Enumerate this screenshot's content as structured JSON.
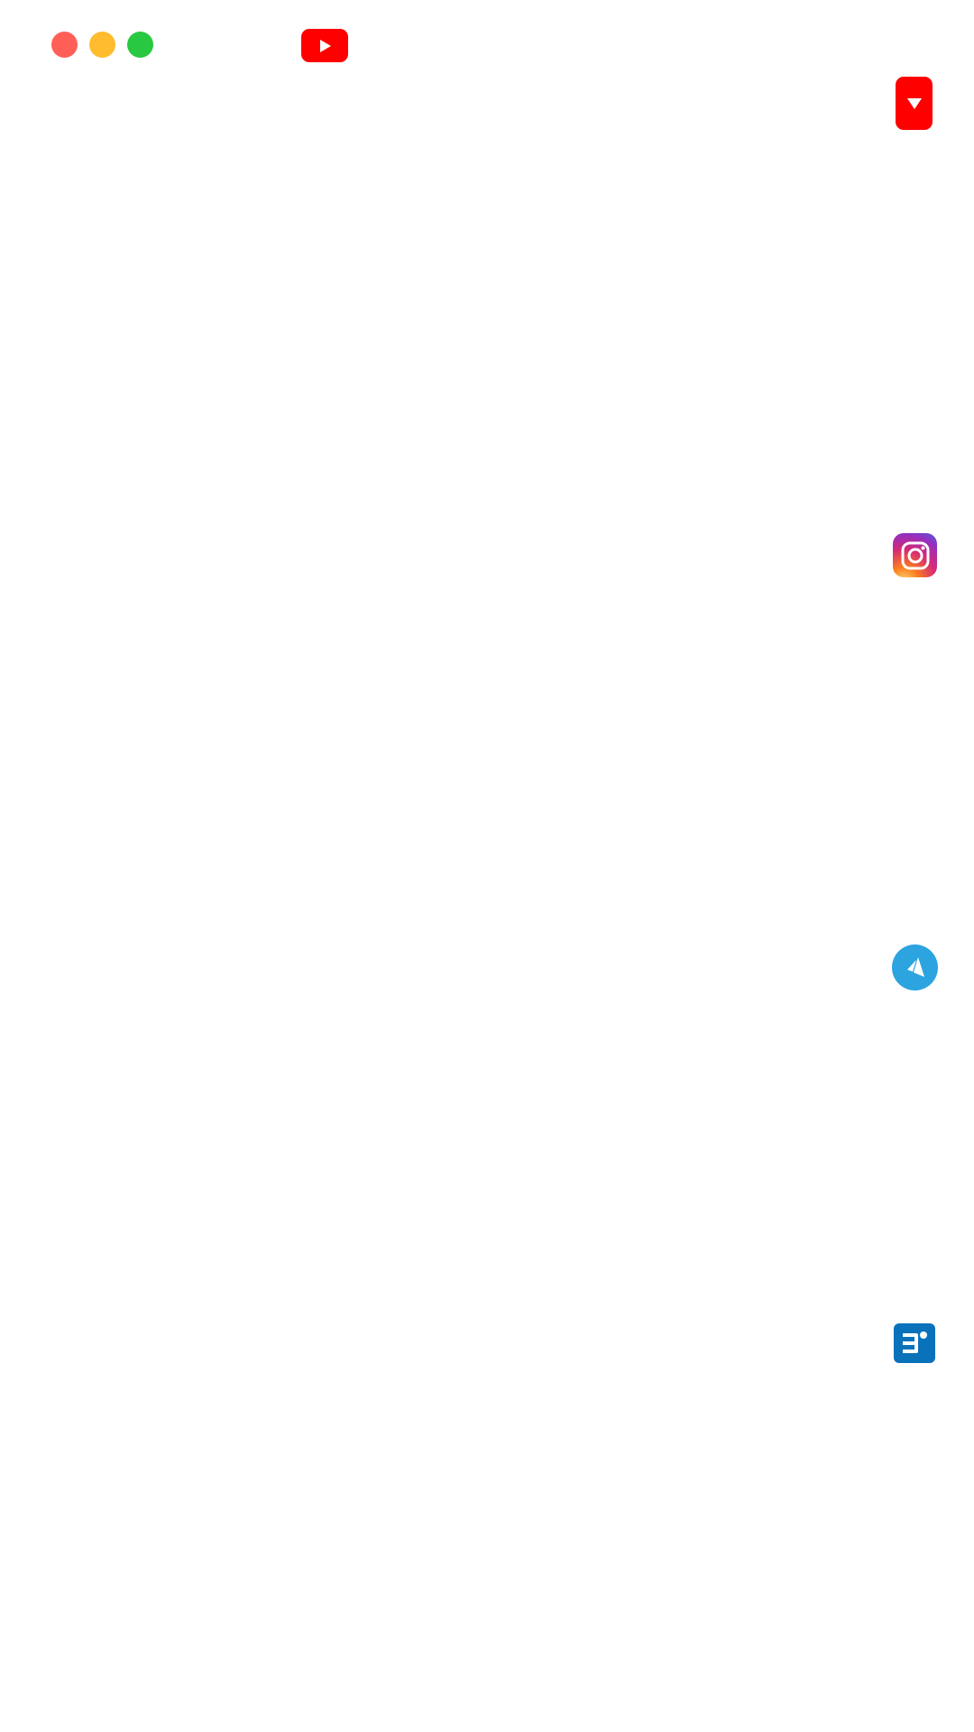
{
  "window": {
    "controls": [
      {
        "name": "close",
        "color": "#FF5F57"
      },
      {
        "name": "minimize",
        "color": "#FEBC2E"
      },
      {
        "name": "maximize",
        "color": "#28C840"
      }
    ]
  },
  "app": {
    "logo_icon": "youtube-icon",
    "logo_color": "#FF0000"
  },
  "side_icons": [
    {
      "icon": "dropdown-arrow-icon",
      "color": "#FF0000"
    },
    {
      "icon": "instagram-icon",
      "colors": [
        "#FEDA75",
        "#FA7E1E",
        "#D62976",
        "#962FBF",
        "#4F5BD5"
      ]
    },
    {
      "icon": "navigation-arrow-icon",
      "color": "#2BA4E0"
    },
    {
      "icon": "document-app-icon",
      "color": "#0A72BA"
    }
  ]
}
